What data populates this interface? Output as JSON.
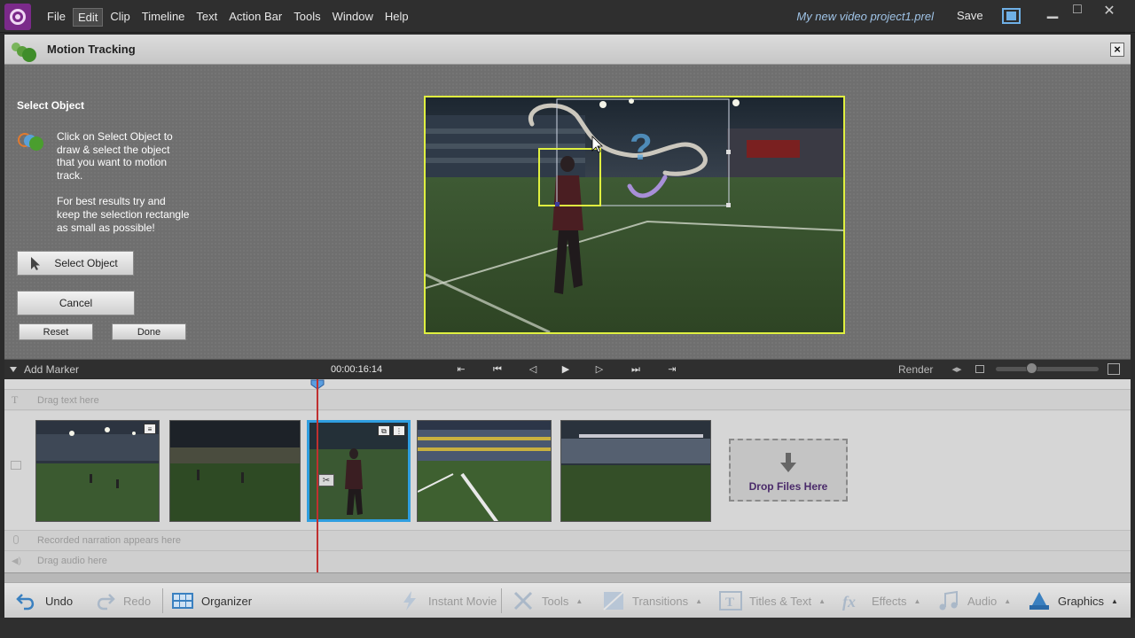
{
  "menubar": {
    "items": [
      "File",
      "Edit",
      "Clip",
      "Timeline",
      "Text",
      "Action Bar",
      "Tools",
      "Window",
      "Help"
    ],
    "active": "Edit",
    "project_name": "My new video project1.prel",
    "save_label": "Save",
    "window_controls": [
      "▁",
      "□",
      "✕"
    ]
  },
  "panel": {
    "title": "Motion Tracking",
    "close_label": "×",
    "select_heading": "Select Object",
    "instruction_1": "Click on Select Object to draw & select the object that you want to motion track.",
    "instruction_2": "For best results try and keep the selection rectangle as small as possible!",
    "select_button": "Select Object",
    "cancel_button": "Cancel",
    "reset_button": "Reset",
    "done_button": "Done"
  },
  "transport": {
    "add_marker": "Add Marker",
    "timecode": "00:00:16:14",
    "render": "Render",
    "controls": [
      "⇤",
      "⏮",
      "◁",
      "▶",
      "▷",
      "⏭",
      "⇥"
    ]
  },
  "timeline": {
    "text_track": "Drag text here",
    "narration_track": "Recorded narration appears here",
    "audio_track": "Drag audio here",
    "drop_files": "Drop Files Here"
  },
  "actionbar": {
    "undo": "Undo",
    "redo": "Redo",
    "organizer": "Organizer",
    "instant_movie": "Instant Movie",
    "tools": "Tools",
    "transitions": "Transitions",
    "titles_text": "Titles & Text",
    "effects": "Effects",
    "audio": "Audio",
    "graphics": "Graphics"
  },
  "colors": {
    "accent_blue": "#2f9ee0",
    "selection_yellow": "#e0f040",
    "playhead_red": "#c03030",
    "brand_purple": "#7b2a8a"
  }
}
